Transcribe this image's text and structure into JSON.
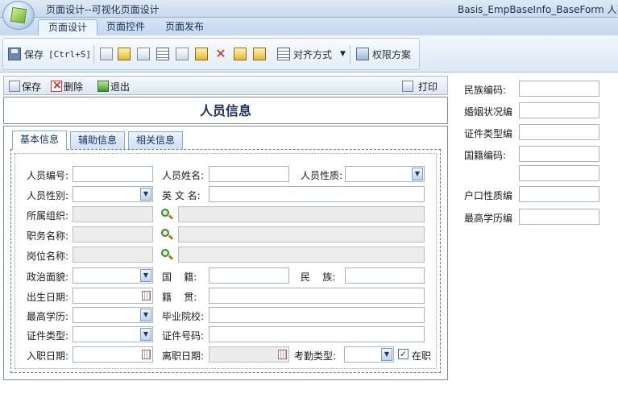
{
  "window": {
    "title": "页面设计--可视化页面设计",
    "form_title": "Basis_EmpBaseInfo_BaseForm  人事"
  },
  "ribbon": {
    "tabs": [
      "页面设计",
      "页面控件",
      "页面发布"
    ],
    "save_label": "保存",
    "save_shortcut": "[Ctrl+S]",
    "align_label": "对齐方式",
    "permission_label": "权限方案"
  },
  "form_toolbar": {
    "save": "保存",
    "delete": "删除",
    "exit": "退出",
    "print": "打印"
  },
  "form": {
    "heading": "人员信息",
    "tabs": [
      "基本信息",
      "辅助信息",
      "相关信息"
    ],
    "labels": {
      "emp_no": "人员编号:",
      "emp_name": "人员姓名:",
      "emp_nature": "人员性质:",
      "gender": "人员性别:",
      "english_name": "英 文 名:",
      "org": "所属组织:",
      "duty": "职务名称:",
      "post": "岗位名称:",
      "politics": "政治面貌:",
      "nationality": "国    籍:",
      "ethnic": "民    族:",
      "birthday": "出生日期:",
      "native_place": "籍    贯:",
      "education": "最高学历:",
      "school": "毕业院校:",
      "cert_type": "证件类型:",
      "cert_no": "证件号码:",
      "join_date": "入职日期:",
      "leave_date": "离职日期:",
      "attendance_type": "考勤类型:",
      "on_duty": "在职"
    },
    "on_duty_checked": true
  },
  "side_fields": [
    "民族编码:",
    "婚姻状况编",
    "证件类型编",
    "国籍编码:",
    "",
    "户口性质编",
    "最高学历编"
  ]
}
